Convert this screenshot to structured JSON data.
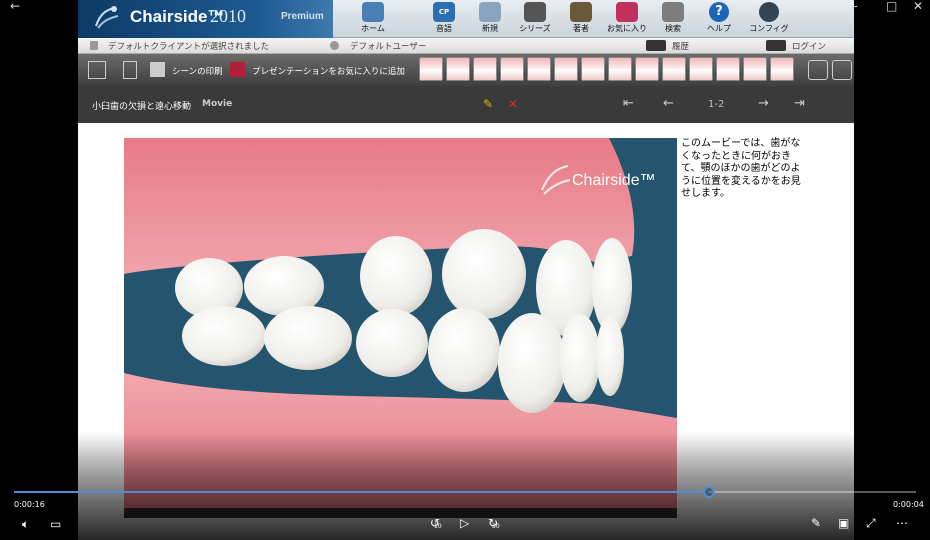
{
  "window": {
    "back_icon": "back-arrow-icon",
    "minimize": "–",
    "maximize": "□",
    "close": "✕"
  },
  "app": {
    "brand_name": "Chairside™",
    "brand_year": "2010",
    "brand_edition": "Premium",
    "top_buttons": [
      {
        "label": "ホーム",
        "icon": "dental-chair-icon",
        "color": "#4a7fb5"
      },
      {
        "label": "音語",
        "icon": "cp-icon",
        "color": "#2d6fb0"
      },
      {
        "label": "新規",
        "icon": "new-doc-icon",
        "color": "#8aa4bf"
      },
      {
        "label": "シリーズ",
        "icon": "clapper-icon",
        "color": "#555555"
      },
      {
        "label": "著者",
        "icon": "author-icon",
        "color": "#6a5a3a"
      },
      {
        "label": "お気に入り",
        "icon": "favorites-icon",
        "color": "#c2315b"
      },
      {
        "label": "検索",
        "icon": "search-icon",
        "color": "#7d7d7d"
      },
      {
        "label": "ヘルプ",
        "icon": "help-icon",
        "color": "#1f63b4"
      },
      {
        "label": "コンフィグ",
        "icon": "config-gear-icon",
        "color": "#334455"
      }
    ],
    "status": {
      "client": "デフォルトクライアントが選択されました",
      "user": "デフォルトユーザー",
      "history": "履歴",
      "login": "ログイン"
    },
    "toolbar": {
      "print": "シーンの印刷",
      "add_favorite": "プレゼンテーションをお気に入りに追加"
    },
    "scene": {
      "title": "小臼歯の欠損と遠心移動",
      "type": "Movie",
      "page": "1-2"
    },
    "video": {
      "watermark": "Chairside™"
    },
    "caption": "このムービーでは、歯がなくなったときに何がおきて、顎のほかの歯がどのように位置を変えるかをお見せします。"
  },
  "player": {
    "elapsed": "0:00:16",
    "remaining": "0:00:04",
    "progress": 0.77,
    "skip_back": "10",
    "skip_forward": "30"
  }
}
